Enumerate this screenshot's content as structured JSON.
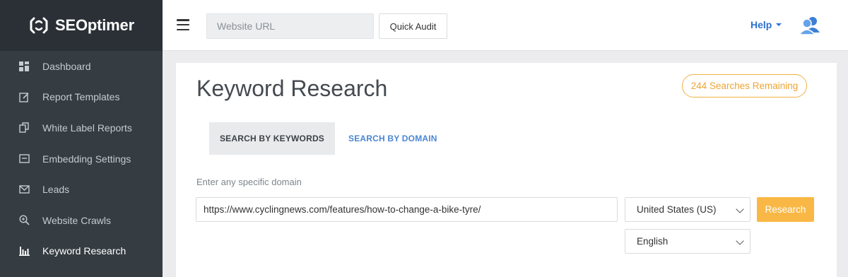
{
  "brand": {
    "name": "SEOptimer"
  },
  "sidebar": {
    "items": [
      {
        "label": "Dashboard",
        "icon": "dashboard-grid-icon"
      },
      {
        "label": "Report Templates",
        "icon": "edit-icon"
      },
      {
        "label": "White Label Reports",
        "icon": "copy-icon"
      },
      {
        "label": "Embedding Settings",
        "icon": "embed-icon"
      },
      {
        "label": "Leads",
        "icon": "envelope-icon"
      },
      {
        "label": "Website Crawls",
        "icon": "search-plus-icon"
      },
      {
        "label": "Keyword Research",
        "icon": "bar-chart-icon",
        "active": true
      }
    ]
  },
  "topbar": {
    "url_placeholder": "Website URL",
    "quick_audit_label": "Quick Audit",
    "help_label": "Help"
  },
  "main": {
    "title": "Keyword Research",
    "searches_remaining": "244 Searches Remaining",
    "tabs": [
      {
        "label": "SEARCH BY KEYWORDS",
        "active": true
      },
      {
        "label": "SEARCH BY DOMAIN",
        "active": false
      }
    ],
    "field_label": "Enter any specific domain",
    "domain_value": "https://www.cyclingnews.com/features/how-to-change-a-bike-tyre/",
    "country": "United States (US)",
    "language": "English",
    "research_label": "Research"
  },
  "colors": {
    "sidebar_bg": "#353c42",
    "accent_orange": "#f9b845",
    "link_blue": "#2d6fd0"
  }
}
